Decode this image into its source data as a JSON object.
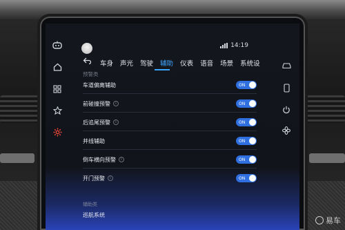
{
  "status_bar": {
    "time": "14:19"
  },
  "tabs": [
    {
      "label": "车身"
    },
    {
      "label": "声光"
    },
    {
      "label": "驾驶"
    },
    {
      "label": "辅助",
      "active": true
    },
    {
      "label": "仪表"
    },
    {
      "label": "语音"
    },
    {
      "label": "场景"
    },
    {
      "label": "系统设"
    }
  ],
  "section": {
    "label": "预警类"
  },
  "settings": [
    {
      "label": "车道偏离辅助",
      "info": false,
      "toggle": "ON"
    },
    {
      "label": "前碰撞预警",
      "info": true,
      "toggle": "ON"
    },
    {
      "label": "后追尾预警",
      "info": true,
      "toggle": "ON"
    },
    {
      "label": "并线辅助",
      "info": false,
      "toggle": "ON"
    },
    {
      "label": "倒车横向预警",
      "info": true,
      "toggle": "ON"
    },
    {
      "label": "开门预警",
      "info": true,
      "toggle": "ON"
    }
  ],
  "bottom": {
    "faded_label": "辅助类",
    "cruise_label": "巡航系统"
  },
  "watermark": {
    "text": "易车"
  },
  "colors": {
    "accent": "#3da5ff",
    "toggle_on": "#2f6fe0",
    "active_rail_icon": "#ff4a3a"
  },
  "icons": {
    "left_rail": [
      "robot-icon",
      "home-icon",
      "apps-icon",
      "star-icon",
      "settings-icon"
    ],
    "right_rail": [
      "car-icon",
      "phone-icon",
      "power-icon",
      "fan-icon"
    ]
  }
}
